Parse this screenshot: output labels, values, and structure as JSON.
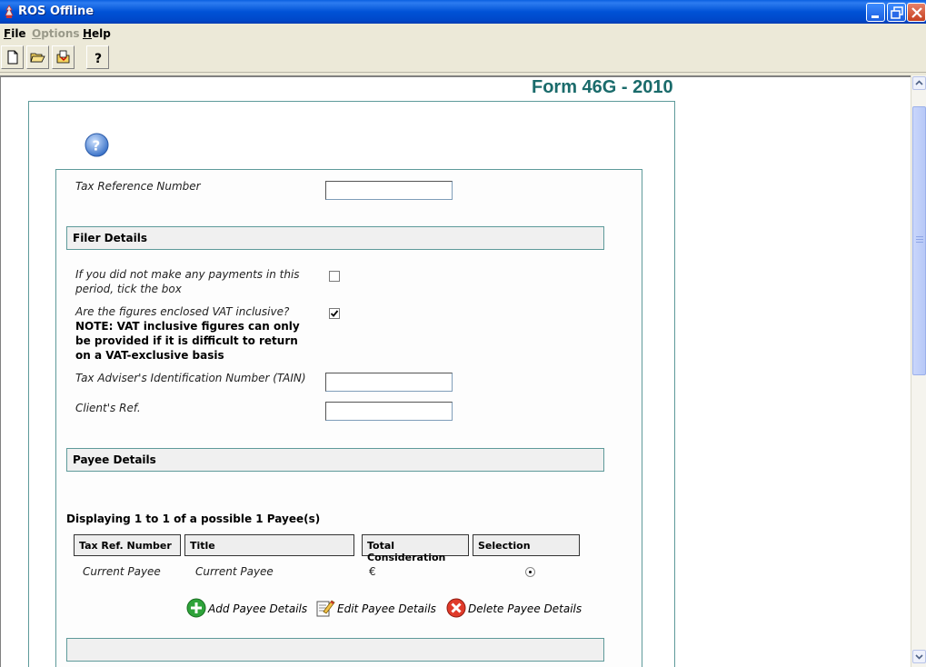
{
  "window": {
    "title": "ROS Offline"
  },
  "menu": [
    {
      "label": "File",
      "enabled": true
    },
    {
      "label": "Options",
      "enabled": false
    },
    {
      "label": "Help",
      "enabled": true
    }
  ],
  "toolbar": [
    {
      "icon": "new-document-icon"
    },
    {
      "icon": "open-folder-icon"
    },
    {
      "icon": "import-icon"
    },
    {
      "icon": "help-question-icon"
    }
  ],
  "form": {
    "title": "Form 46G - 2010",
    "tax_ref_label": "Tax Reference Number",
    "tax_ref_value": "",
    "filer_section": "Filer Details",
    "no_payments_label": "If you did not make any payments in this period, tick the box",
    "no_payments_checked": false,
    "vat_inclusive_label": "Are the figures enclosed VAT inclusive?",
    "vat_note": "NOTE: VAT inclusive figures can only be provided if it is difficult to return on a VAT-exclusive basis",
    "vat_inclusive_checked": true,
    "tain_label": "Tax Adviser's Identification Number (TAIN)",
    "tain_value": "",
    "client_ref_label": "Client's Ref.",
    "client_ref_value": "",
    "payee_section": "Payee Details",
    "display_text": "Displaying 1 to 1 of a possible 1 Payee(s)",
    "table": {
      "headers": [
        "Tax Ref. Number",
        "Title",
        "Total Consideration",
        "Selection"
      ],
      "rows": [
        {
          "tax_ref": "Current Payee",
          "title": "Current Payee",
          "total": "€",
          "selected": true
        }
      ]
    },
    "actions": {
      "add": "Add Payee Details",
      "edit": "Edit Payee Details",
      "delete": "Delete Payee Details"
    }
  },
  "colors": {
    "accent": "#1a6b6b",
    "titlebar": "#0052d6",
    "frame": "#5e9a9a"
  }
}
